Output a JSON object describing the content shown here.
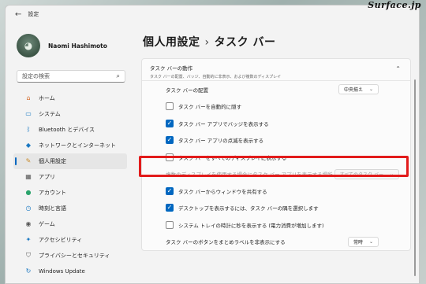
{
  "window": {
    "title": "設定",
    "back_icon": "back-arrow-icon"
  },
  "watermark": "Surface.jp",
  "profile": {
    "name": "Naomi Hashimoto"
  },
  "search": {
    "placeholder": "設定の検索"
  },
  "nav": [
    {
      "label": "ホーム",
      "icon": "home-icon",
      "glyph": "⌂",
      "color": "#d46b2c"
    },
    {
      "label": "システム",
      "icon": "system-icon",
      "glyph": "▭",
      "color": "#1a78c2"
    },
    {
      "label": "Bluetooth とデバイス",
      "icon": "bluetooth-icon",
      "glyph": "ᛒ",
      "color": "#1a78c2"
    },
    {
      "label": "ネットワークとインターネット",
      "icon": "network-icon",
      "glyph": "◆",
      "color": "#1a78c2"
    },
    {
      "label": "個人用設定",
      "icon": "personalization-icon",
      "glyph": "✎",
      "color": "#c98a2a"
    },
    {
      "label": "アプリ",
      "icon": "apps-icon",
      "glyph": "▦",
      "color": "#555555"
    },
    {
      "label": "アカウント",
      "icon": "account-icon",
      "glyph": "●",
      "color": "#2aa36b"
    },
    {
      "label": "時刻と言語",
      "icon": "time-language-icon",
      "glyph": "◷",
      "color": "#1a78c2"
    },
    {
      "label": "ゲーム",
      "icon": "gaming-icon",
      "glyph": "◉",
      "color": "#555555"
    },
    {
      "label": "アクセシビリティ",
      "icon": "accessibility-icon",
      "glyph": "✦",
      "color": "#1a78c2"
    },
    {
      "label": "プライバシーとセキュリティ",
      "icon": "privacy-shield-icon",
      "glyph": "⛉",
      "color": "#555555"
    },
    {
      "label": "Windows Update",
      "icon": "windows-update-icon",
      "glyph": "↻",
      "color": "#1a78c2"
    }
  ],
  "active_nav_index": 4,
  "breadcrumb": {
    "parent": "個人用設定",
    "separator": "›",
    "current": "タスク バー"
  },
  "section": {
    "title": "タスク バーの動作",
    "subtitle": "タスク バーの配置、バッジ、自動的に非表示、および複数のディスプレイ"
  },
  "rows": {
    "alignment": {
      "label": "タスク バーの配置",
      "value": "中央揃え"
    },
    "autohide": {
      "label": "タスク バーを自動的に隠す",
      "checked": false
    },
    "badges": {
      "label": "タスク バー アプリでバッジを表示する",
      "checked": true
    },
    "flashing": {
      "label": "タスク バー アプリの点滅を表示する",
      "checked": true
    },
    "all_displays": {
      "label": "タスク バーをすべてのディスプレイに表示する",
      "checked": false
    },
    "multi_display": {
      "label": "複数のディスプレイを使用する場合にタスク バー アプリを表示する場所",
      "value": "すべてのタスク バー"
    },
    "share_window": {
      "label": "タスク バーからウィンドウを共有する",
      "checked": true
    },
    "show_desktop": {
      "label": "デスクトップを表示するには、タスク バーの隅を選択します",
      "checked": true
    },
    "seconds_clock": {
      "label": "システム トレイの時計に秒を表示する (電力消費が増加します)",
      "checked": false
    },
    "combine": {
      "label": "タスク バーのボタンをまとめラベルを非表示にする",
      "value": "常時"
    }
  },
  "colors": {
    "accent": "#0067c0",
    "highlight": "#e21b1b"
  }
}
